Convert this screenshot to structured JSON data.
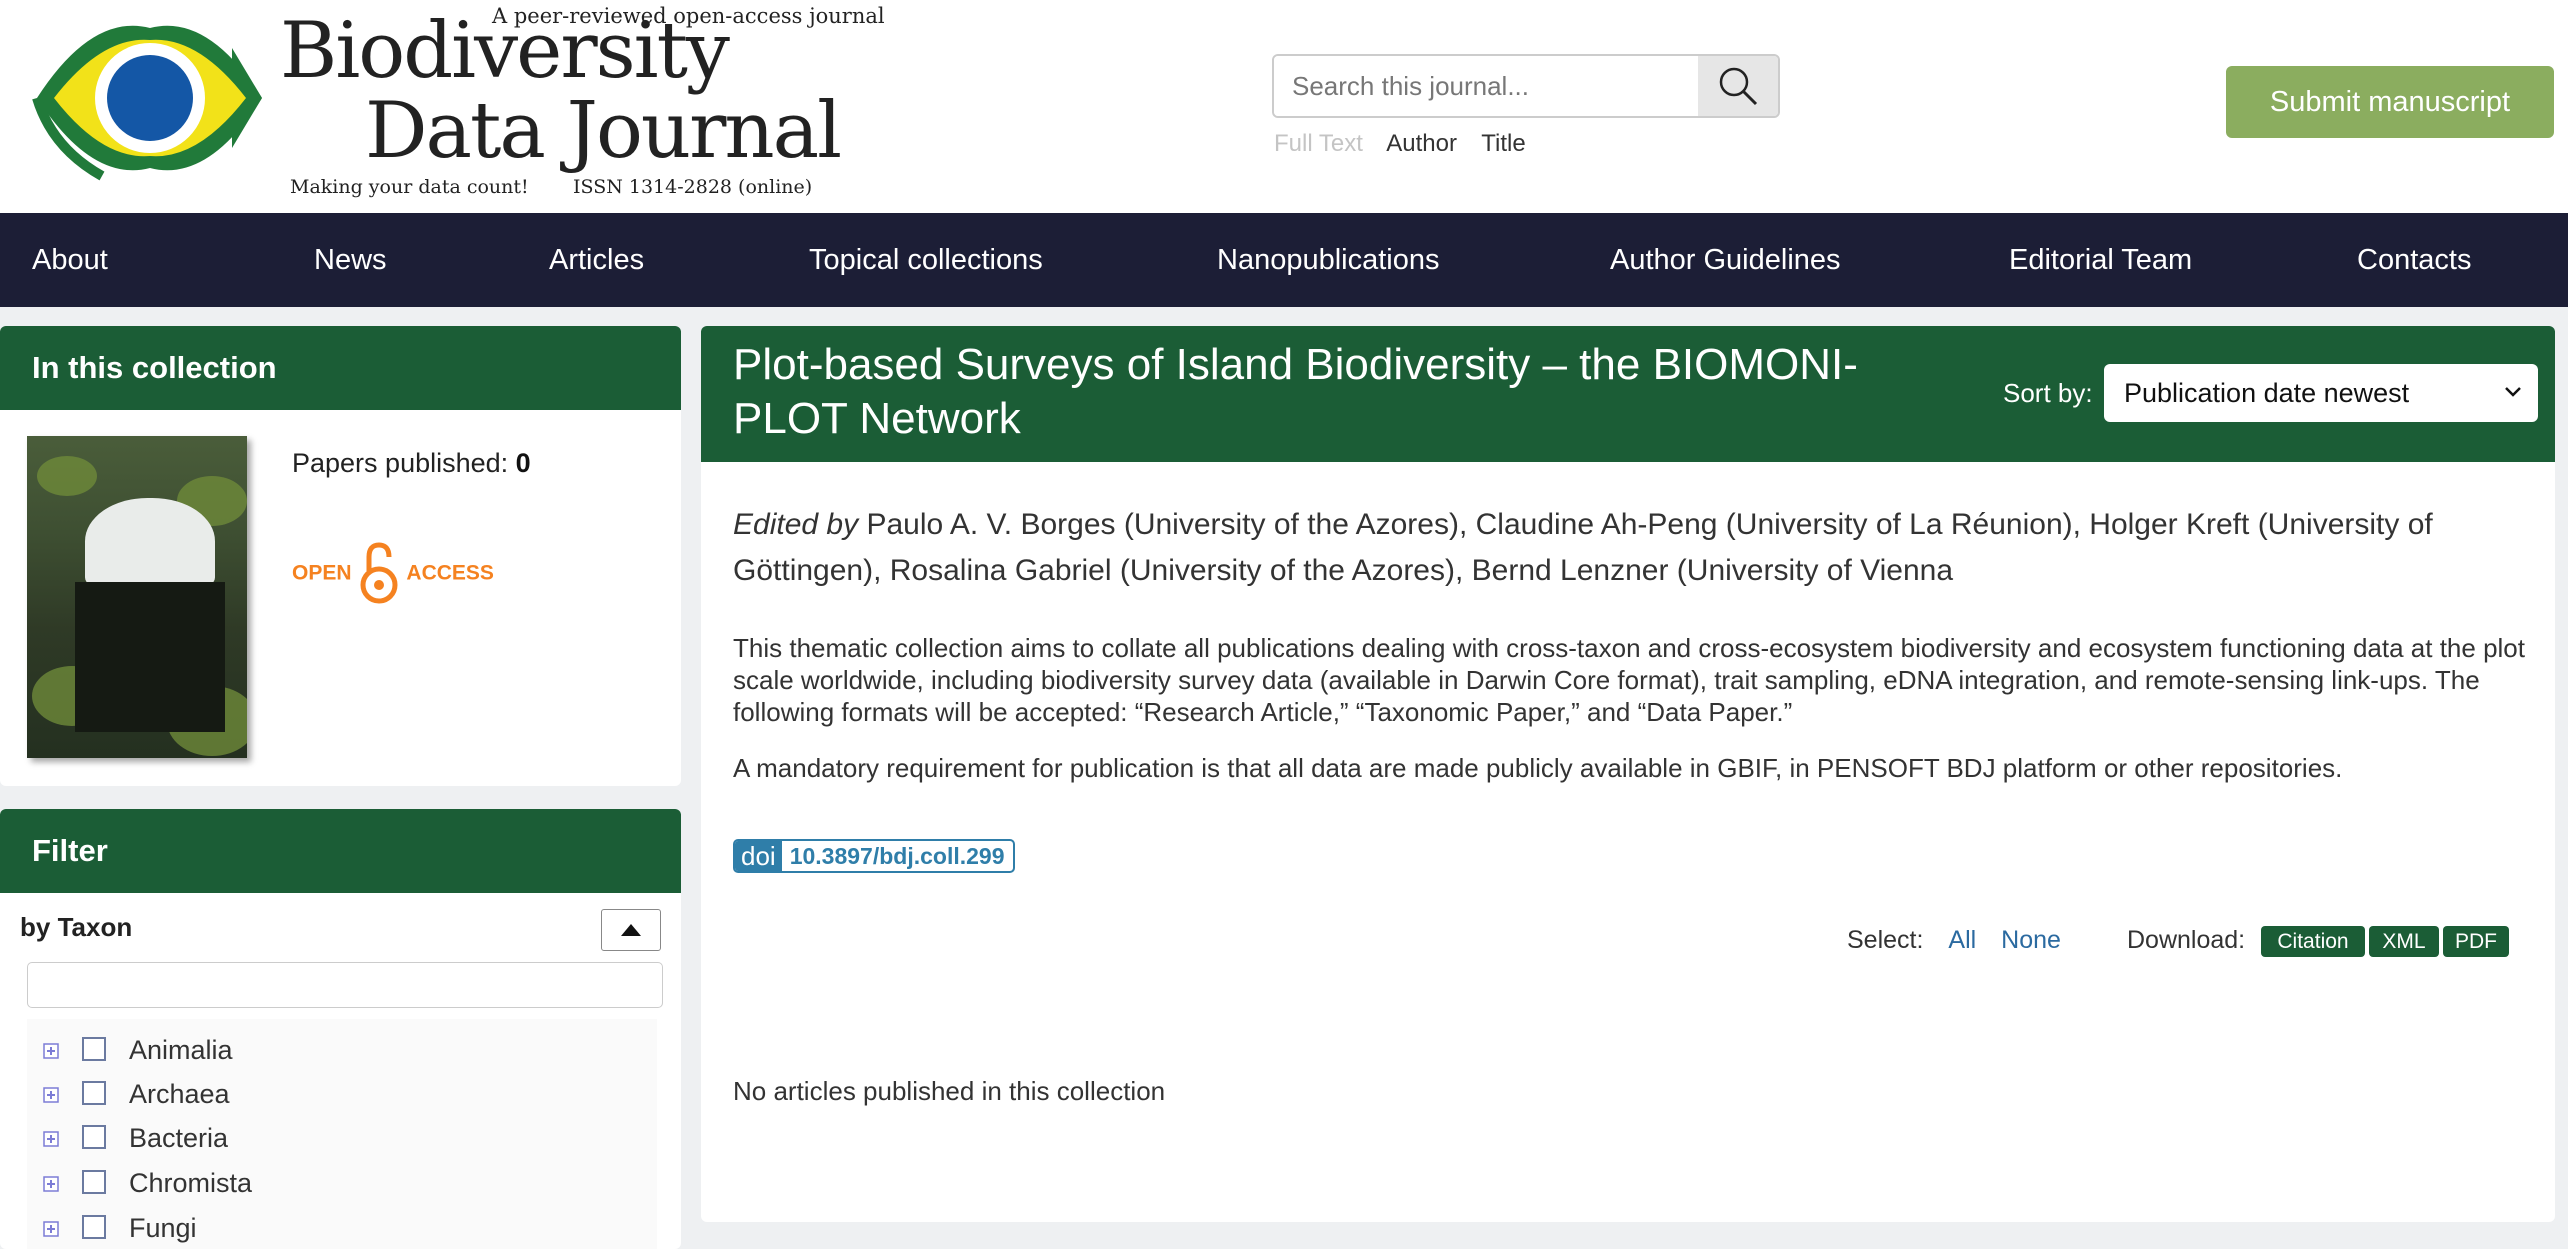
{
  "logo": {
    "tagline_top": "A peer-reviewed open-access journal",
    "title_line1": "Biodiversity",
    "title_line2": "Data Journal",
    "tagline_bottom": "Making your data count!",
    "issn": "ISSN 1314-2828 (online)"
  },
  "search": {
    "placeholder": "Search this journal...",
    "options": [
      "Full Text",
      "Author",
      "Title"
    ]
  },
  "submit_label": "Submit manuscript",
  "nav": [
    "About",
    "News",
    "Articles",
    "Topical collections",
    "Nanopublications",
    "Author Guidelines",
    "Editorial Team",
    "Contacts"
  ],
  "collection_panel": {
    "heading": "In this collection",
    "papers_label": "Papers published:",
    "papers_count": "0",
    "open_access_left": "OPEN",
    "open_access_right": "ACCESS"
  },
  "filter_panel": {
    "heading": "Filter",
    "by_taxon": "by Taxon",
    "taxa": [
      "Animalia",
      "Archaea",
      "Bacteria",
      "Chromista",
      "Fungi"
    ]
  },
  "collection": {
    "title": "Plot-based Surveys of Island Biodiversity – the BIOMONI-PLOT Network",
    "sort_label": "Sort by:",
    "sort_value": "Publication date newest",
    "edited_by_label": "Edited by",
    "editors": "Paulo A. V. Borges (University of the Azores), Claudine Ah-Peng (University of La Réunion), Holger Kreft (University of Göttingen), Rosalina Gabriel (University of the Azores), Bernd Lenzner (University of Vienna",
    "description": "This thematic collection aims to collate all publications dealing with cross-taxon and cross-ecosystem biodiversity and ecosystem functioning data at the plot scale worldwide, including biodiversity survey data (available in Darwin Core format), trait sampling, eDNA integration, and remote-sensing link-ups. The following formats will be accepted: “Research Article,” “Taxonomic Paper,” and “Data Paper.”",
    "requirement": "A mandatory requirement for publication is that all data are made publicly available in GBIF, in PENSOFT BDJ platform or other repositories.",
    "doi_tag": "doi",
    "doi_value": "10.3897/bdj.coll.299",
    "select_label": "Select:",
    "select_all": "All",
    "select_none": "None",
    "download_label": "Download:",
    "download_citation": "Citation",
    "download_xml": "XML",
    "download_pdf": "PDF",
    "empty_message": "No articles published in this collection"
  },
  "colors": {
    "brand_green": "#1b5d36",
    "nav_bg": "#1c1e36",
    "submit_green": "#8bad5f",
    "doi_blue": "#2f7ea9",
    "oa_orange": "#f58220"
  }
}
